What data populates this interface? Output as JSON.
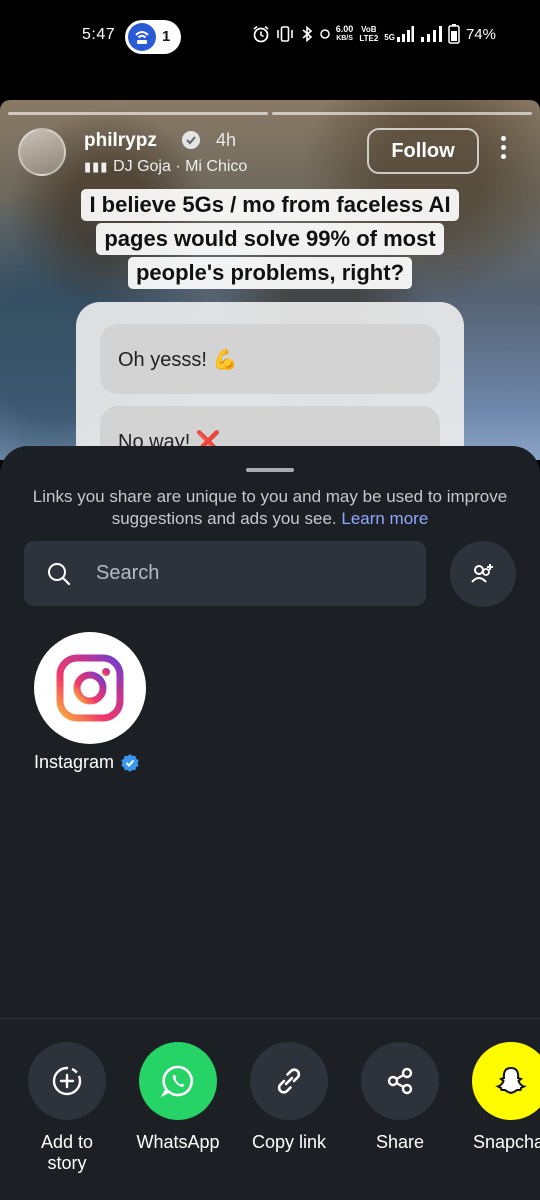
{
  "status_bar": {
    "time": "5:47",
    "hotspot_count": "1",
    "net_speed_value": "6.00",
    "net_speed_unit": "KB/S",
    "volte_top": "VoB",
    "volte_bottom": "LTE2",
    "network_5g": "5G",
    "battery": "74%"
  },
  "story": {
    "username": "philrypz",
    "time_ago": "4h",
    "music": "DJ Goja · Mi Chico",
    "follow_label": "Follow",
    "caption_lines": [
      "I believe 5Gs / mo from faceless AI",
      "pages would solve 99% of most",
      "people's problems, right?"
    ],
    "poll_options": [
      "Oh yesss! 💪",
      "No way! ❌"
    ]
  },
  "share_sheet": {
    "notice_text": "Links you share are unique to you and may be used to improve suggestions and ads you see.",
    "learn_more": "Learn more",
    "search_placeholder": "Search",
    "contacts": [
      {
        "name": "Instagram",
        "verified": true
      }
    ],
    "actions": [
      {
        "label": "Add to story",
        "icon": "add-story-icon"
      },
      {
        "label": "WhatsApp",
        "icon": "whatsapp-icon"
      },
      {
        "label": "Copy link",
        "icon": "link-icon"
      },
      {
        "label": "Share",
        "icon": "share-icon"
      },
      {
        "label": "Snapchat",
        "icon": "snapchat-icon"
      }
    ],
    "colors": {
      "sheet_bg": "#1c1f24",
      "whatsapp_green": "#25d366",
      "snapchat_yellow": "#fffc00",
      "link_blue": "#8ba9ff",
      "verified_blue": "#3897f0"
    }
  }
}
